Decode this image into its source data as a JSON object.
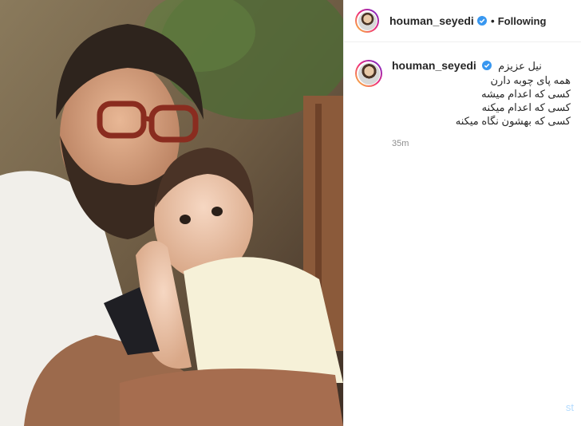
{
  "post": {
    "author": "houman_seyedi",
    "follow_status": "Following",
    "separator": "•",
    "caption": {
      "username": "houman_seyedi",
      "lines": [
        "نیل عزیزم",
        "همه پای چوبه دارن",
        "کسی که اعدام میشه",
        "کسی که اعدام میکنه",
        "کسی که بهشون نگاه میکنه"
      ]
    },
    "timestamp": "35m",
    "partial_text": "st"
  },
  "colors": {
    "accent_blue": "#3897f0",
    "text": "#262626",
    "muted": "#8e8e8e"
  },
  "icons": {
    "verified": "verified-badge-icon",
    "avatar": "profile-avatar"
  }
}
